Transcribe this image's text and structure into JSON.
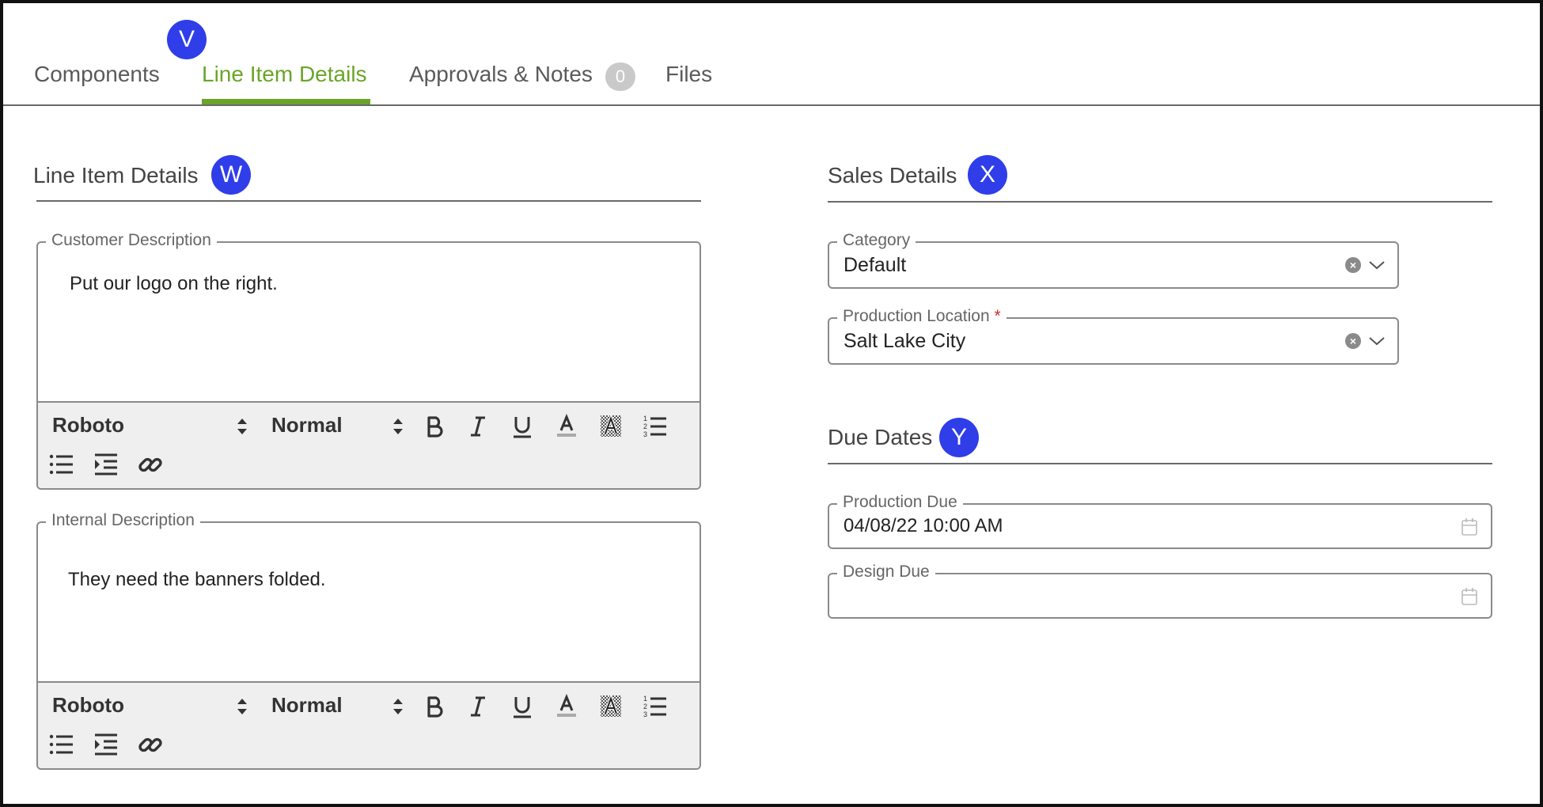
{
  "tabs": {
    "components": "Components",
    "line_item_details": "Line Item Details",
    "approvals_notes": "Approvals & Notes",
    "approvals_count": "0",
    "files": "Files"
  },
  "markers": {
    "v": "V",
    "w": "W",
    "x": "X",
    "y": "Y"
  },
  "line_item": {
    "title": "Line Item Details",
    "customer_description": {
      "label": "Customer Description",
      "text": "Put our logo on the right."
    },
    "internal_description": {
      "label": "Internal Description",
      "text": "They need the banners folded."
    },
    "toolbar": {
      "font": "Roboto",
      "size": "Normal",
      "icons": [
        "bold-icon",
        "italic-icon",
        "underline-icon",
        "text-color-icon",
        "background-color-icon",
        "ordered-list-icon",
        "bullet-list-icon",
        "indent-icon",
        "link-icon"
      ]
    }
  },
  "sales": {
    "title": "Sales Details",
    "category": {
      "label": "Category",
      "value": "Default"
    },
    "production_location": {
      "label": "Production Location",
      "required_mark": "*",
      "value": "Salt Lake City"
    }
  },
  "due_dates": {
    "title": "Due Dates",
    "production_due": {
      "label": "Production Due",
      "value": "04/08/22 10:00 AM"
    },
    "design_due": {
      "label": "Design Due",
      "value": ""
    }
  },
  "colors": {
    "accent_green": "#6aa528",
    "marker_blue": "#2f3ee8",
    "required_red": "#d3272e"
  }
}
